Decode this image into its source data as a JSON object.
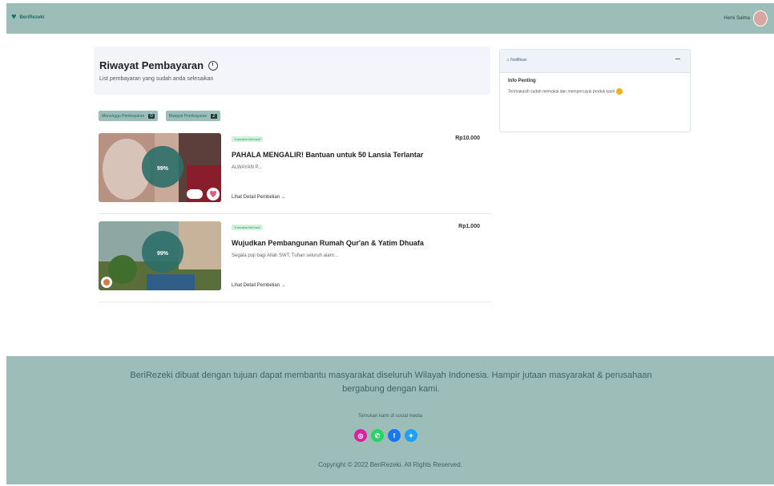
{
  "nav": {
    "brand": "BeriRezeki",
    "user_name": "Hemi Salma"
  },
  "history": {
    "title": "Riwayat Pembayaran",
    "subtitle": "List pembayaran yang sudah anda selesaikan",
    "tabs": [
      {
        "label": "Menunggu Pembayaran",
        "count": "0"
      },
      {
        "label": "Riwayat Pembayaran",
        "count": "2"
      }
    ]
  },
  "transactions": [
    {
      "status": "Transaksi Berhasil",
      "amount": "Rp10.000",
      "title": "PAHALA MENGALIR! Bantuan untuk 50 Lansia Terlantar",
      "description": "ALWAYAN P...",
      "detail_link": "Lihat Detail Pembelian",
      "likes": "0"
    },
    {
      "status": "Transaksi Berhasil",
      "amount": "Rp1.000",
      "title": "Wujudkan Pembangunan Rumah Qur'an & Yatim Dhuafa",
      "description": "Segala puji bagi Allah SWT, Tuhan seluruh alam...",
      "detail_link": "Lihat Detail Pembelian"
    }
  ],
  "notification": {
    "header": "Notifikasi",
    "title": "Info Penting",
    "text": "Terimakasih sudah memakai dan mempercayai produk kami"
  },
  "footer": {
    "description": "BeriRezeki dibuat dengan tujuan dapat membantu masyarakat diseluruh Wilayah Indonesia. Hampir jutaan masyarakat & perusahaan bergabung dengan kami.",
    "social_label": "Temukan kami di sosial media",
    "copyright": "Copyright © 2022 BeriRezeki. All Rights Reserved.",
    "socials": [
      {
        "name": "instagram",
        "color": "#d6249f"
      },
      {
        "name": "whatsapp",
        "color": "#25d366"
      },
      {
        "name": "facebook",
        "color": "#1877f2"
      },
      {
        "name": "twitter",
        "color": "#1da1f2"
      }
    ]
  }
}
